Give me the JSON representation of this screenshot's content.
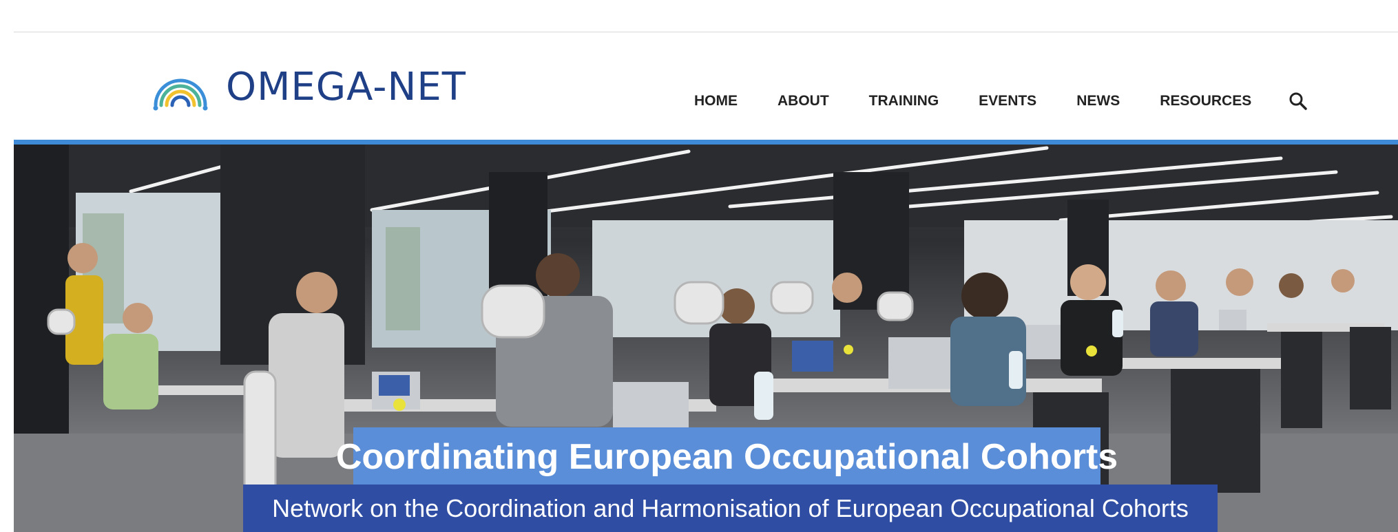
{
  "brand": {
    "name": "OMEGA-NET",
    "logo_icon": "rainbow-arch-logo",
    "text_color": "#1f3f86"
  },
  "nav": {
    "items": [
      {
        "label": "HOME"
      },
      {
        "label": "ABOUT"
      },
      {
        "label": "TRAINING"
      },
      {
        "label": "EVENTS"
      },
      {
        "label": "NEWS"
      },
      {
        "label": "RESOURCES"
      }
    ],
    "search_icon": "search-icon"
  },
  "hero": {
    "title": "Coordinating European Occupational Cohorts",
    "subtitle": "Network on the Coordination and Harmonisation of European Occupational Cohorts",
    "image": "open-plan office with people working at laptops",
    "accent_color": "#3f8ad6",
    "title_bg": "#5b8ed8",
    "subtitle_bg": "#2f4da3"
  }
}
